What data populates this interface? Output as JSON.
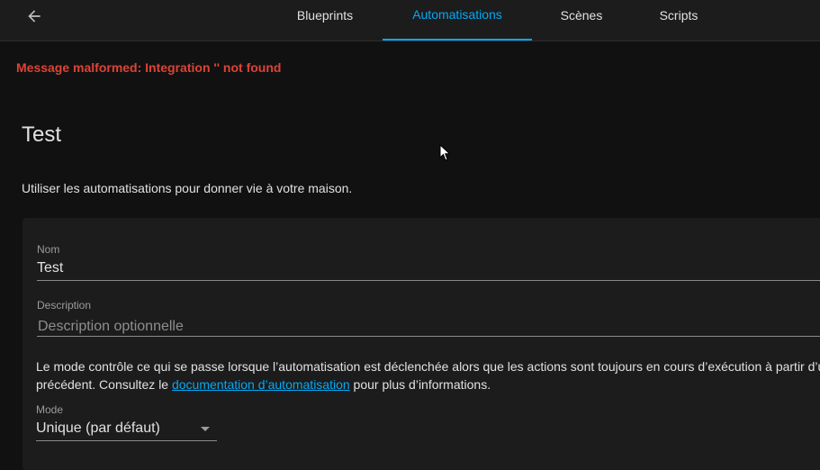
{
  "header": {
    "tabs": [
      {
        "label": "Blueprints",
        "active": false
      },
      {
        "label": "Automatisations",
        "active": true
      },
      {
        "label": "Scènes",
        "active": false
      },
      {
        "label": "Scripts",
        "active": false
      }
    ],
    "back_icon": "arrow-left-icon"
  },
  "error_message": "Message malformed: Integration '' not found",
  "page": {
    "title": "Test",
    "intro": "Utiliser les automatisations pour donner vie à votre maison."
  },
  "form": {
    "name": {
      "label": "Nom",
      "value": "Test"
    },
    "description": {
      "label": "Description",
      "placeholder": "Description optionnelle",
      "value": ""
    },
    "help_text_before": "Le mode contrôle ce qui se passe lorsque l’automatisation est déclenchée alors que les actions sont toujours en cours d’exécution à partir d’u",
    "help_text_line2_before": "précédent. Consultez le ",
    "help_link": "documentation d’automatisation",
    "help_text_after": " pour plus d’informations.",
    "mode": {
      "label": "Mode",
      "value": "Unique (par défaut)",
      "icon": "menu-down-icon"
    }
  },
  "colors": {
    "accent": "#03a9f4",
    "error": "#db4437",
    "background": "#111111",
    "card": "#1c1c1c"
  }
}
